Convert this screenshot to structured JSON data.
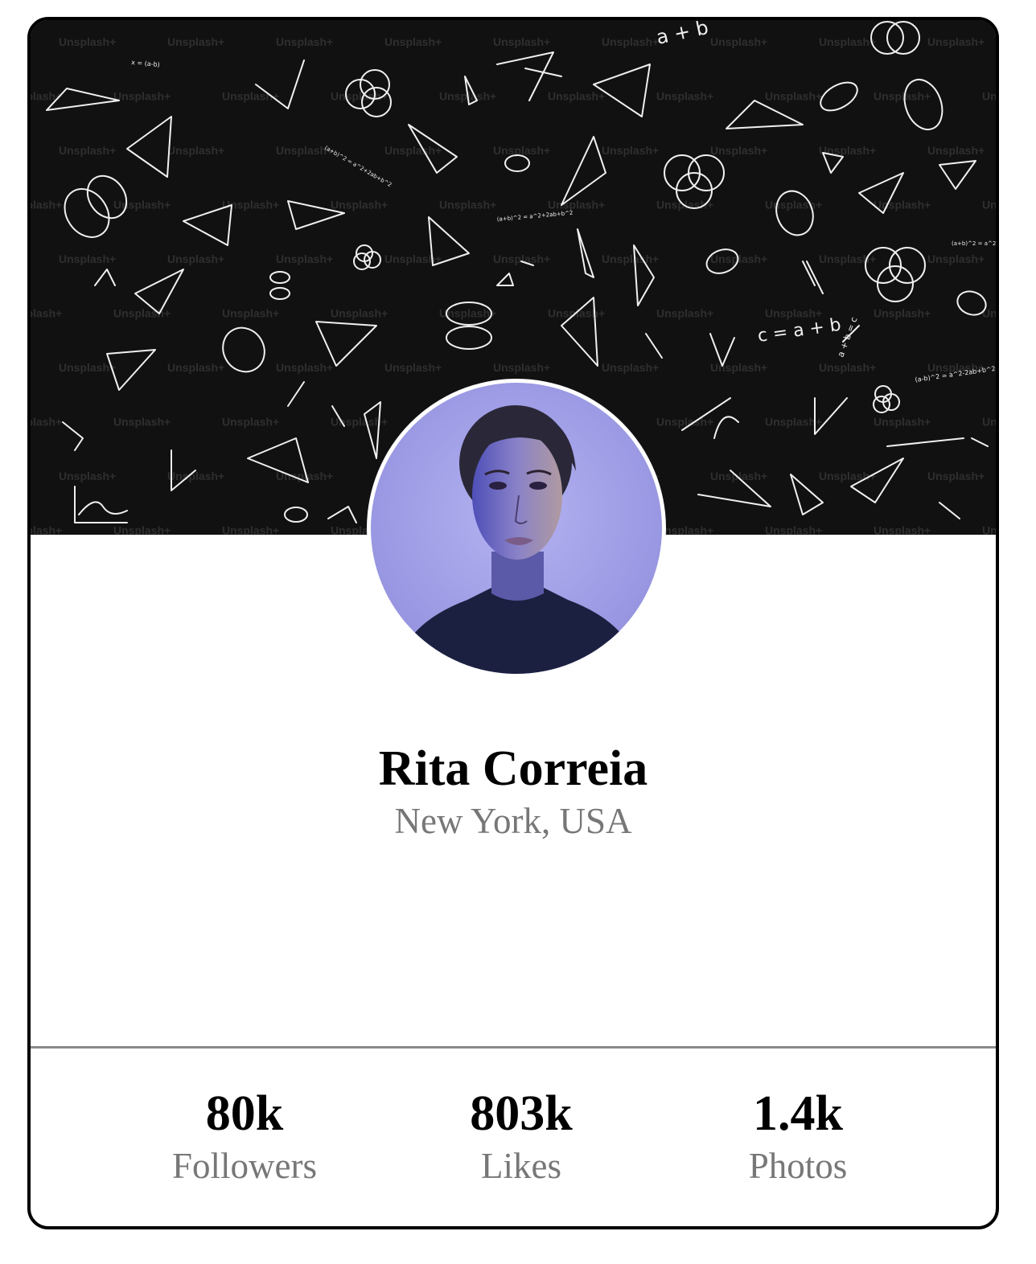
{
  "profile": {
    "name": "Rita Correia",
    "location": "New York, USA"
  },
  "cover": {
    "watermark": "Unsplash+",
    "formulas": [
      "a + b",
      "c = a + b",
      "a + b = c",
      "(a+b)^2 = a^2+2ab+b^2",
      "x = (a-b)",
      "(a-b)^2 = a^2-2ab+b^2"
    ]
  },
  "stats": [
    {
      "value": "80k",
      "label": "Followers"
    },
    {
      "value": "803k",
      "label": "Likes"
    },
    {
      "value": "1.4k",
      "label": "Photos"
    }
  ],
  "colors": {
    "cover_background": "#111111",
    "border": "#000000",
    "secondary_text": "#777777",
    "avatar_background": "#a9a8ec"
  }
}
